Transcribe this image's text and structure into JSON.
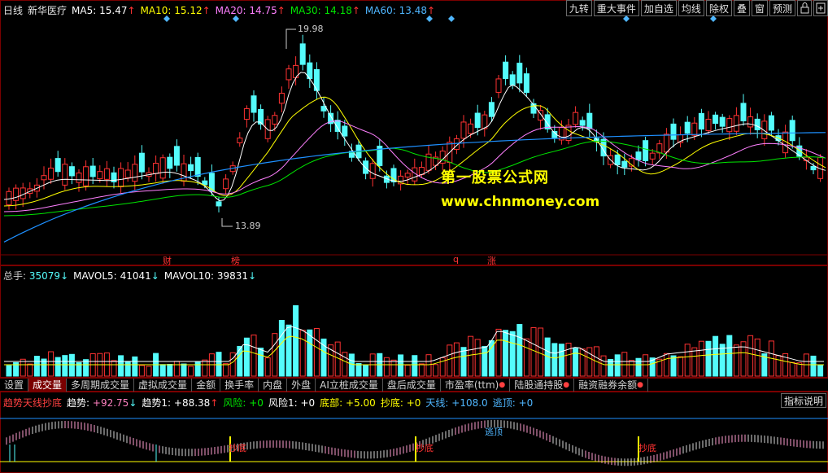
{
  "main_header": {
    "period": "日线",
    "stock": "新华医疗",
    "ma5_label": "MA5:",
    "ma5_value": "15.47",
    "ma10_label": "MA10:",
    "ma10_value": "15.12",
    "ma20_label": "MA20:",
    "ma20_value": "14.75",
    "ma30_label": "MA30:",
    "ma30_value": "14.18",
    "ma60_label": "MA60:",
    "ma60_value": "13.48",
    "arrow_up": "↑",
    "arrow_down": "↓"
  },
  "toolbar": {
    "items": [
      "九转",
      "重大事件",
      "加自选",
      "均线",
      "除权",
      "叠",
      "窗",
      "预测"
    ],
    "lock_icon": "lock-icon",
    "expand_icon": "expand-icon"
  },
  "price_annotations": {
    "high": "19.98",
    "low": "13.89",
    "markers": [
      "财",
      "榜",
      "q",
      "涨"
    ]
  },
  "watermark": {
    "title": "第一股票公式网",
    "url": "www.chnmoney.com"
  },
  "volume_header": {
    "total_label": "总手:",
    "total_value": "35079",
    "mavol5_label": "MAVOL5:",
    "mavol5_value": "41041",
    "mavol10_label": "MAVOL10:",
    "mavol10_value": "39831"
  },
  "tabs": [
    {
      "label": "设置",
      "active": false,
      "star": false
    },
    {
      "label": "成交量",
      "active": true,
      "star": false
    },
    {
      "label": "多周期成交量",
      "active": false,
      "star": false
    },
    {
      "label": "虚拟成交量",
      "active": false,
      "star": false
    },
    {
      "label": "金额",
      "active": false,
      "star": false
    },
    {
      "label": "换手率",
      "active": false,
      "star": false
    },
    {
      "label": "内盘",
      "active": false,
      "star": false
    },
    {
      "label": "外盘",
      "active": false,
      "star": false
    },
    {
      "label": "AI立桩成交量",
      "active": false,
      "star": false
    },
    {
      "label": "盘后成交量",
      "active": false,
      "star": false
    },
    {
      "label": "市盈率(ttm)",
      "active": false,
      "star": true
    },
    {
      "label": "陆股通持股",
      "active": false,
      "star": true
    },
    {
      "label": "融资融券余额",
      "active": false,
      "star": true
    }
  ],
  "indicator_header": {
    "name": "趋势天线抄底",
    "trend_label": "趋势:",
    "trend_value": "+92.75",
    "trend1_label": "趋势1:",
    "trend1_value": "+88.38",
    "risk_label": "风险:",
    "risk_value": "+0",
    "risk1_label": "风险1:",
    "risk1_value": "+0",
    "bottom_label": "底部:",
    "bottom_value": "+5.00",
    "chaodi_label": "抄底:",
    "chaodi_value": "+0",
    "sky_label": "天线:",
    "sky_value": "+108.0",
    "escape_label": "逃顶:",
    "escape_value": "+0",
    "help_button": "指标说明"
  },
  "indicator_labels": {
    "chaodi": "抄底",
    "taoding": "逃顶"
  },
  "colors": {
    "up": "#ff3232",
    "down": "#54fcfc",
    "ma5": "#ffffff",
    "ma10": "#ffff00",
    "ma20": "#ff80ff",
    "ma30": "#00e600",
    "ma60": "#1e90ff",
    "frame": "#7a0000"
  }
}
